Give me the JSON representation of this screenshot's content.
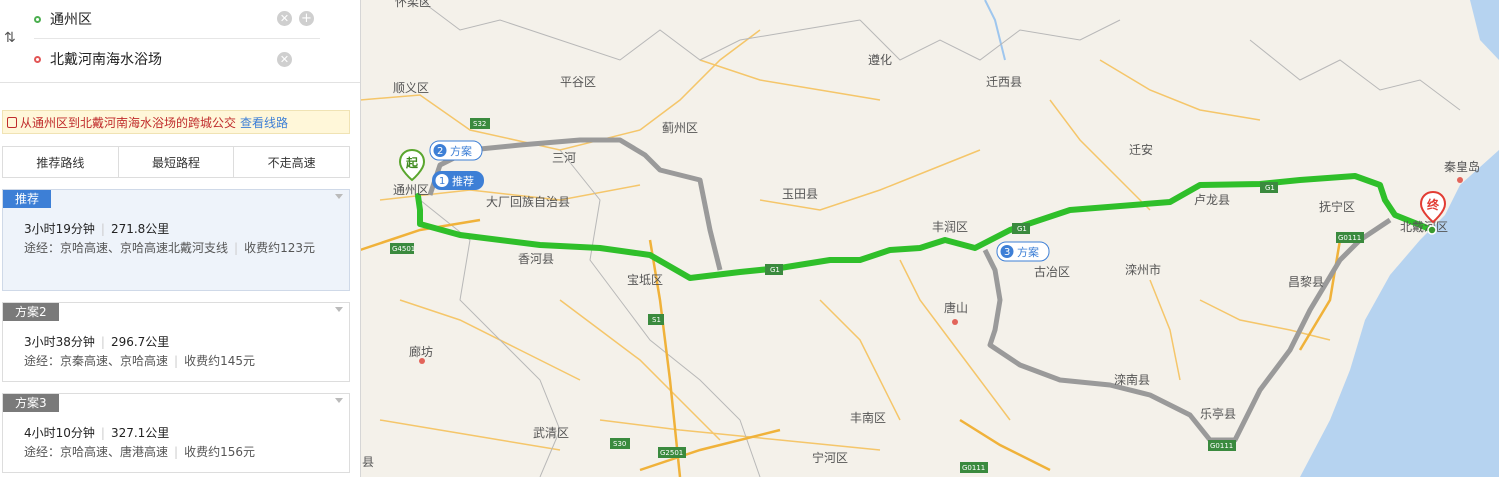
{
  "search": {
    "from": "通州区",
    "to": "北戴河南海水浴场",
    "swap_icon": "swap-vertical-icon"
  },
  "bus_tip": {
    "text": "从通州区到北戴河南海水浴场的跨城公交",
    "link": "查看线路"
  },
  "tabs": [
    "推荐路线",
    "最短路程",
    "不走高速"
  ],
  "routes": [
    {
      "badge": "推荐",
      "time": "3小时19分钟",
      "distance": "271.8公里",
      "via": "途经：京哈高速、京哈高速北戴河支线",
      "toll": "收费约123元"
    },
    {
      "badge": "方案2",
      "time": "3小时38分钟",
      "distance": "296.7公里",
      "via": "途经：京秦高速、京哈高速",
      "toll": "收费约145元"
    },
    {
      "badge": "方案3",
      "time": "4小时10分钟",
      "distance": "327.1公里",
      "via": "途经：京哈高速、唐港高速",
      "toll": "收费约156元"
    }
  ],
  "map": {
    "places": [
      "怀柔区",
      "顺义区",
      "平谷区",
      "遵化",
      "迁西县",
      "蓟州区",
      "三河",
      "通州区",
      "大厂回族自治县",
      "玉田县",
      "迁安",
      "卢龙县",
      "秦皇岛",
      "抚宁区",
      "北戴河区",
      "香河县",
      "宝坻区",
      "丰润区",
      "古冶区",
      "滦州市",
      "昌黎县",
      "唐山",
      "廊坊",
      "滦南县",
      "乐亭县",
      "丰南区",
      "武清区",
      "宁河区",
      "县"
    ],
    "highways": [
      "S32",
      "G4501",
      "G1",
      "G1",
      "G1",
      "S1",
      "G0111",
      "S30",
      "G2501",
      "G0111",
      "G0111"
    ],
    "markers": {
      "start": "起",
      "end": "终"
    },
    "callouts": [
      {
        "num": "2",
        "label": "方案"
      },
      {
        "num": "1",
        "label": "推荐"
      },
      {
        "num": "3",
        "label": "方案"
      }
    ]
  },
  "colors": {
    "accent": "#3d7fd6",
    "route": "#2fbf2a",
    "alt_route": "#9a9a9a",
    "sea": "#b6d3f0"
  }
}
